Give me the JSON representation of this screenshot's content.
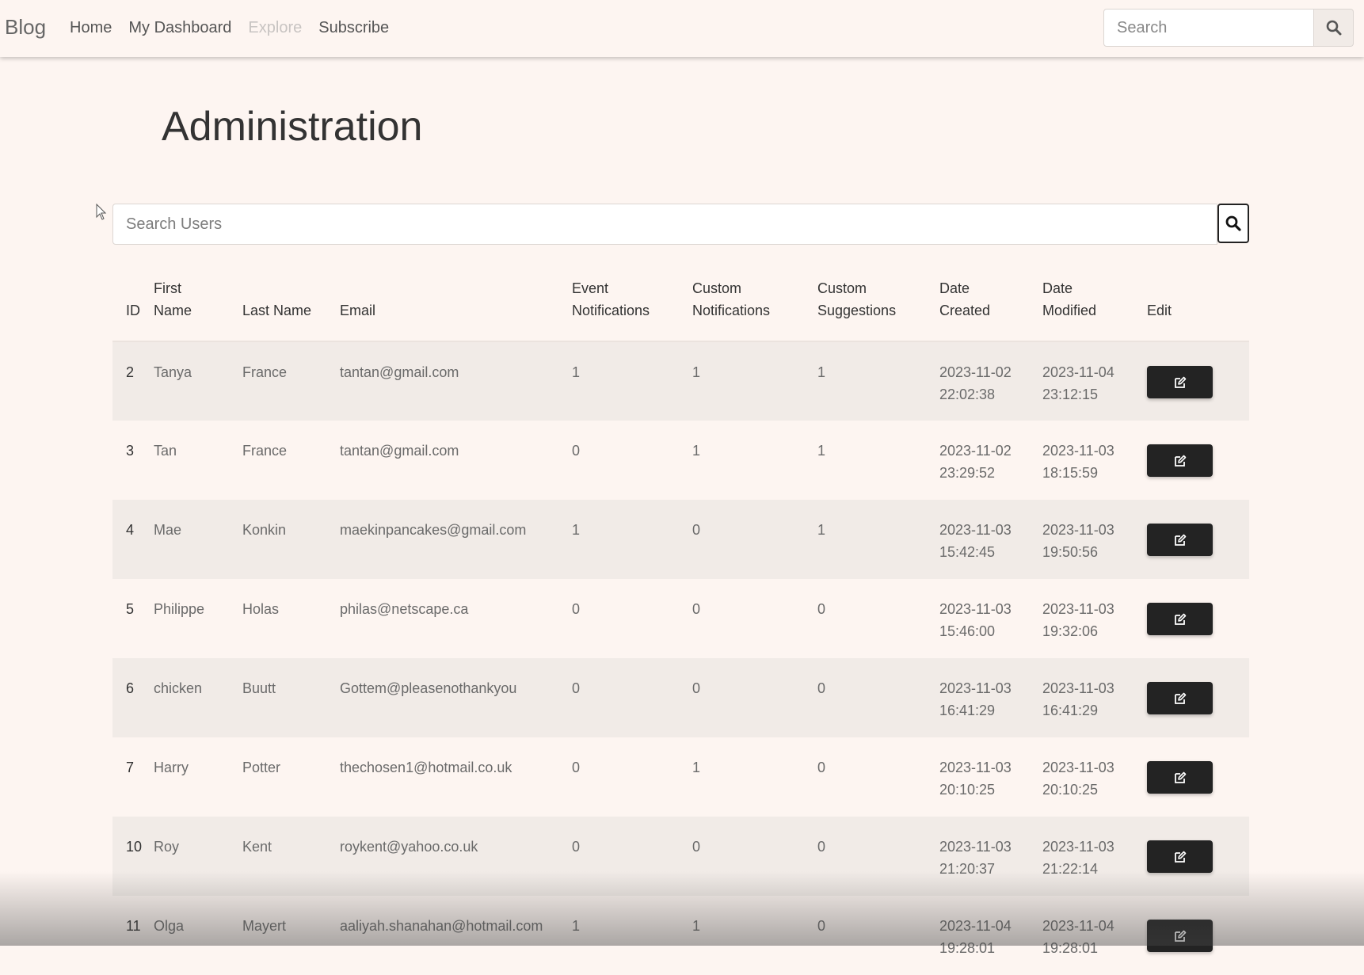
{
  "nav": {
    "brand": "Blog",
    "links": [
      {
        "label": "Home",
        "disabled": false
      },
      {
        "label": "My Dashboard",
        "disabled": false
      },
      {
        "label": "Explore",
        "disabled": true
      },
      {
        "label": "Subscribe",
        "disabled": false
      }
    ],
    "search_placeholder": "Search",
    "search_icon": "search-icon"
  },
  "page": {
    "title": "Administration",
    "user_search_placeholder": "Search Users"
  },
  "table": {
    "headers": [
      "ID",
      "First Name",
      "Last Name",
      "Email",
      "Event Notifications",
      "Custom Notifications",
      "Custom Suggestions",
      "Date Created",
      "Date Modified",
      "Edit"
    ],
    "edit_icon": "edit-icon",
    "rows": [
      {
        "id": "2",
        "first": "Tanya",
        "last": "France",
        "email": "tantan@gmail.com",
        "event": "1",
        "notif": "1",
        "sugg": "1",
        "created_date": "2023-11-02",
        "created_time": "22:02:38",
        "modified_date": "2023-11-04",
        "modified_time": "23:12:15"
      },
      {
        "id": "3",
        "first": "Tan",
        "last": "France",
        "email": "tantan@gmail.com",
        "event": "0",
        "notif": "1",
        "sugg": "1",
        "created_date": "2023-11-02",
        "created_time": "23:29:52",
        "modified_date": "2023-11-03",
        "modified_time": "18:15:59"
      },
      {
        "id": "4",
        "first": "Mae",
        "last": "Konkin",
        "email": "maekinpancakes@gmail.com",
        "event": "1",
        "notif": "0",
        "sugg": "1",
        "created_date": "2023-11-03",
        "created_time": "15:42:45",
        "modified_date": "2023-11-03",
        "modified_time": "19:50:56"
      },
      {
        "id": "5",
        "first": "Philippe",
        "last": "Holas",
        "email": "philas@netscape.ca",
        "event": "0",
        "notif": "0",
        "sugg": "0",
        "created_date": "2023-11-03",
        "created_time": "15:46:00",
        "modified_date": "2023-11-03",
        "modified_time": "19:32:06"
      },
      {
        "id": "6",
        "first": "chicken",
        "last": "Buutt",
        "email": "Gottem@pleasenothankyou",
        "event": "0",
        "notif": "0",
        "sugg": "0",
        "created_date": "2023-11-03",
        "created_time": "16:41:29",
        "modified_date": "2023-11-03",
        "modified_time": "16:41:29"
      },
      {
        "id": "7",
        "first": "Harry",
        "last": "Potter",
        "email": "thechosen1@hotmail.co.uk",
        "event": "0",
        "notif": "1",
        "sugg": "0",
        "created_date": "2023-11-03",
        "created_time": "20:10:25",
        "modified_date": "2023-11-03",
        "modified_time": "20:10:25"
      },
      {
        "id": "10",
        "first": "Roy",
        "last": "Kent",
        "email": "roykent@yahoo.co.uk",
        "event": "0",
        "notif": "0",
        "sugg": "0",
        "created_date": "2023-11-03",
        "created_time": "21:20:37",
        "modified_date": "2023-11-03",
        "modified_time": "21:22:14"
      },
      {
        "id": "11",
        "first": "Olga",
        "last": "Mayert",
        "email": "aaliyah.shanahan@hotmail.com",
        "event": "1",
        "notif": "1",
        "sugg": "0",
        "created_date": "2023-11-04",
        "created_time": "19:28:01",
        "modified_date": "2023-11-04",
        "modified_time": "19:28:01"
      }
    ]
  }
}
